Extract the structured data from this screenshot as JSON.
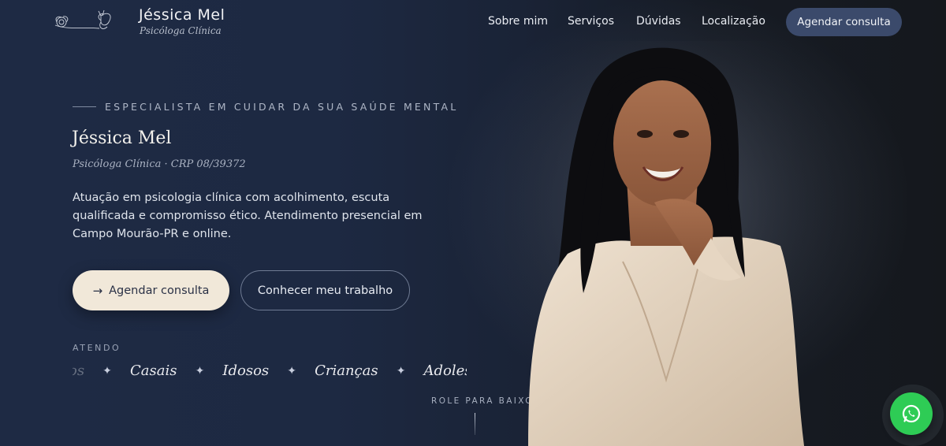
{
  "header": {
    "brand_name": "Jéssica Mel",
    "brand_subtitle": "Psicóloga Clínica",
    "logo_icon": "butterfly-flower-logo",
    "nav": [
      {
        "label": "Sobre mim"
      },
      {
        "label": "Serviços"
      },
      {
        "label": "Dúvidas"
      },
      {
        "label": "Localização"
      }
    ],
    "cta_label": "Agendar consulta"
  },
  "hero": {
    "eyebrow": "ESPECIALISTA EM CUIDAR DA SUA SAÚDE MENTAL",
    "title": "Jéssica Mel",
    "subtitle": "Psicóloga Clínica · CRP 08/39372",
    "description": "Atuação em psicologia clínica com acolhimento, escuta qualificada e compromisso ético. Atendimento presencial em Campo Mourão-PR e online.",
    "primary_button": "Agendar consulta",
    "primary_button_icon": "arrow-right-icon",
    "secondary_button": "Conhecer meu trabalho",
    "atendo_label": "ATENDO",
    "audiences": [
      "ltos",
      "Casais",
      "Idosos",
      "Crianças",
      "Adolescentes"
    ],
    "separator_icon": "sparkle-icon",
    "scroll_hint": "ROLE PARA BAIXO"
  },
  "floating": {
    "whatsapp_icon": "whatsapp-icon"
  },
  "colors": {
    "background": "#1d2942",
    "cta_dark": "#3b4a6b",
    "cta_light": "#f1e8d9",
    "whatsapp": "#2ecc55",
    "blazer": "#e6d6c2"
  }
}
